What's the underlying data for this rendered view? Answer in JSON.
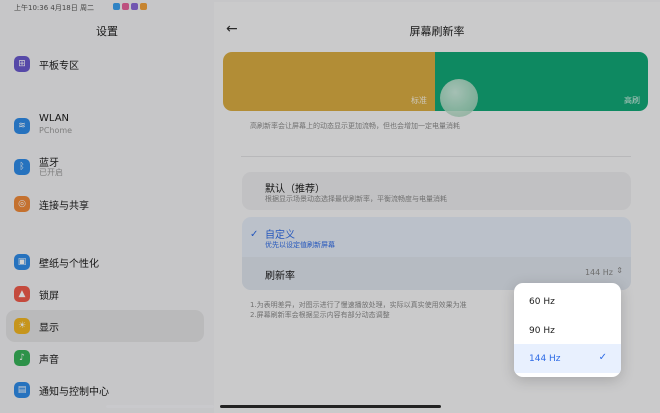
{
  "status_bar": {
    "time_date": "上午10:36 4月18日 周二",
    "notification_colors": [
      "#3aa0f0",
      "#e7639b",
      "#8a6ad8",
      "#f2a23a"
    ]
  },
  "left_panel": {
    "title": "设置",
    "items": [
      {
        "label": "平板专区",
        "sub": "",
        "icon": "grid-icon",
        "glyph": "⊞",
        "color": "#6a5acd"
      },
      {
        "label": "WLAN",
        "sub": "PChome",
        "icon": "wifi-icon",
        "glyph": "≋",
        "color": "#2f8be8"
      },
      {
        "label": "蓝牙",
        "sub": "已开启",
        "icon": "bluetooth-icon",
        "glyph": "ᛒ",
        "color": "#2f8be8"
      },
      {
        "label": "连接与共享",
        "sub": "",
        "icon": "share-icon",
        "glyph": "◎",
        "color": "#f08a3a"
      },
      {
        "label": "壁纸与个性化",
        "sub": "",
        "icon": "wallpaper-icon",
        "glyph": "▣",
        "color": "#2f8be8"
      },
      {
        "label": "锁屏",
        "sub": "",
        "icon": "lock-icon",
        "glyph": "▲",
        "color": "#ef5b4b"
      },
      {
        "label": "显示",
        "sub": "",
        "icon": "sun-icon",
        "glyph": "☀",
        "color": "#f2b623"
      },
      {
        "label": "声音",
        "sub": "",
        "icon": "sound-icon",
        "glyph": "♪",
        "color": "#37b35a"
      },
      {
        "label": "通知与控制中心",
        "sub": "",
        "icon": "notification-icon",
        "glyph": "▤",
        "color": "#2f8be8"
      }
    ]
  },
  "right_panel": {
    "title": "屏幕刷新率",
    "preview": {
      "standard_label": "标准",
      "high_label": "高刷"
    },
    "description": "高刷新率会让屏幕上的动态显示更加流畅，但也会增加一定电量消耗",
    "option_default": {
      "title": "默认（推荐）",
      "subtitle": "根据显示场景动态选择最优刷新率，平衡流畅度与电量消耗"
    },
    "option_custom": {
      "title": "自定义",
      "subtitle": "优先以设定值刷新屏幕",
      "checked": true
    },
    "refresh_rate": {
      "label": "刷新率",
      "value": "144 Hz"
    },
    "notes": [
      "1.为表明差异，对图示进行了慢速播放处理，实际以真实使用效果为准",
      "2.屏幕刷新率会根据显示内容有部分动态调整"
    ]
  },
  "dropdown": {
    "options": [
      "60 Hz",
      "90 Hz",
      "144 Hz"
    ],
    "selected": "144 Hz"
  }
}
